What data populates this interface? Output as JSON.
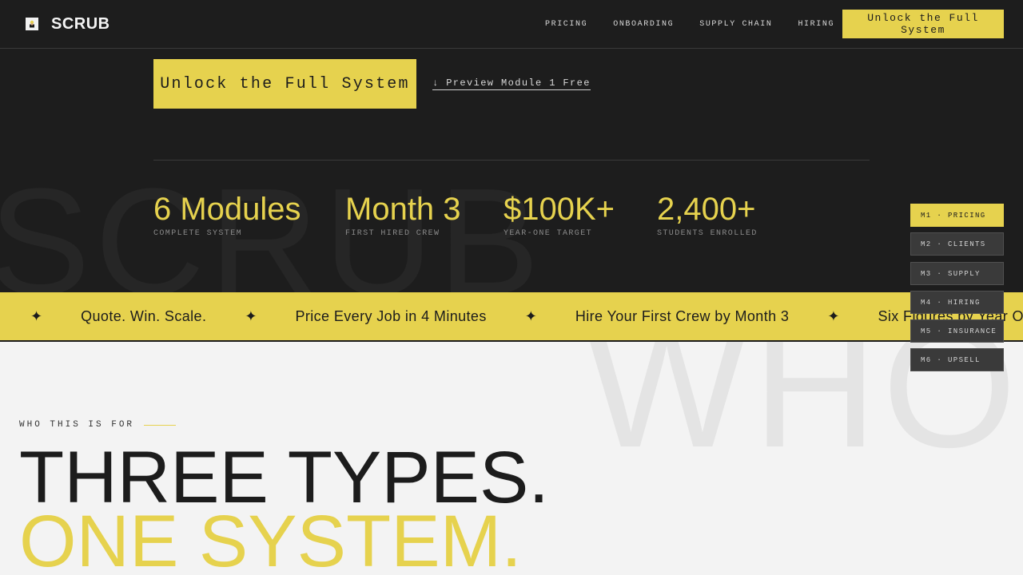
{
  "brand": {
    "name": "SCRUB",
    "accent": "#e6d24e",
    "logo_icon": "chef-icon"
  },
  "nav": {
    "links": [
      "PRICING",
      "ONBOARDING",
      "SUPPLY CHAIN",
      "HIRING"
    ],
    "cta_label": "Unlock the Full System"
  },
  "hero": {
    "cta_label": "Unlock the Full System",
    "preview_label": "↓ Preview Module 1 Free",
    "background_word": "SCRUB"
  },
  "stats": [
    {
      "value": "6 Modules",
      "label": "COMPLETE SYSTEM"
    },
    {
      "value": "Month 3",
      "label": "FIRST HIRED CREW"
    },
    {
      "value": "$100K+",
      "label": "YEAR-ONE TARGET"
    },
    {
      "value": "2,400+",
      "label": "STUDENTS ENROLLED"
    }
  ],
  "marquee": {
    "separator": "✦",
    "phrases": [
      "Quote. Win. Scale.",
      "Price Every Job in 4 Minutes",
      "Hire Your First Crew by Month 3",
      "Six Figures by Year One"
    ]
  },
  "audience": {
    "eyebrow": "WHO THIS IS FOR",
    "heading_line1": "THREE TYPES.",
    "heading_line2": "ONE SYSTEM.",
    "background_word": "WHO"
  },
  "modules": [
    {
      "label": "M1 · PRICING",
      "active": true
    },
    {
      "label": "M2 · CLIENTS",
      "active": false
    },
    {
      "label": "M3 · SUPPLY",
      "active": false
    },
    {
      "label": "M4 · HIRING",
      "active": false
    },
    {
      "label": "M5 · INSURANCE",
      "active": false
    },
    {
      "label": "M6 · UPSELL",
      "active": false
    }
  ]
}
